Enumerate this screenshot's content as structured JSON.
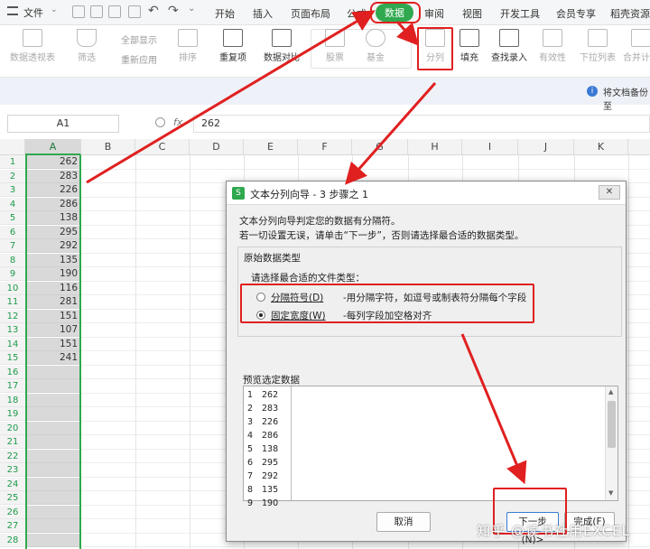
{
  "menubar": {
    "file_label": "文件",
    "tabs": [
      "开始",
      "插入",
      "页面布局",
      "公式",
      "数据",
      "审阅",
      "视图",
      "开发工具",
      "会员专享",
      "稻壳资源"
    ]
  },
  "toolbar": {
    "items": [
      "数据透视表",
      "筛选",
      "排序",
      "重复项",
      "数据对比",
      "股票",
      "基金",
      "分列",
      "填充",
      "查找录入",
      "有效性",
      "下拉列表",
      "合并计算"
    ],
    "show_all": "全部显示",
    "reapply": "重新应用"
  },
  "notice": {
    "text": "将文档备份至"
  },
  "formula_bar": {
    "cell_ref": "A1",
    "fx_symbol": "fx",
    "value": "262"
  },
  "columns": [
    "A",
    "B",
    "C",
    "D",
    "E",
    "F",
    "G",
    "H",
    "I",
    "J",
    "K"
  ],
  "rows": [
    "1",
    "2",
    "3",
    "4",
    "5",
    "6",
    "7",
    "8",
    "9",
    "10",
    "11",
    "12",
    "13",
    "14",
    "15",
    "16",
    "17",
    "18",
    "19",
    "20",
    "21",
    "22",
    "23",
    "24",
    "25",
    "26",
    "27",
    "28"
  ],
  "columnA": [
    "262",
    "283",
    "226",
    "286",
    "138",
    "295",
    "292",
    "135",
    "190",
    "116",
    "281",
    "151",
    "107",
    "151",
    "241"
  ],
  "dialog": {
    "title": "文本分列向导 - 3 步骤之 1",
    "intro1": "文本分列向导判定您的数据有分隔符。",
    "intro2": "若一切设置无误，请单击“下一步”，否则请选择最合适的数据类型。",
    "group_label": "原始数据类型",
    "prompt": "请选择最合适的文件类型：",
    "option1": "分隔符号(D)",
    "option1_desc": "-用分隔字符，如逗号或制表符分隔每个字段",
    "option2": "固定宽度(W)",
    "option2_desc": "-每列字段加空格对齐",
    "preview_label": "预览选定数据",
    "preview_rows": [
      {
        "n": "1",
        "v": "262"
      },
      {
        "n": "2",
        "v": "283"
      },
      {
        "n": "3",
        "v": "226"
      },
      {
        "n": "4",
        "v": "286"
      },
      {
        "n": "5",
        "v": "138"
      },
      {
        "n": "6",
        "v": "295"
      },
      {
        "n": "7",
        "v": "292"
      },
      {
        "n": "8",
        "v": "135"
      },
      {
        "n": "9",
        "v": "190"
      }
    ],
    "cancel": "取消",
    "next": "下一步(N)>",
    "finish": "完成(F)"
  },
  "watermark": "知乎 @读书社用EXCEL",
  "colors": {
    "accent": "#2fa84f",
    "annotation": "#e02020"
  }
}
